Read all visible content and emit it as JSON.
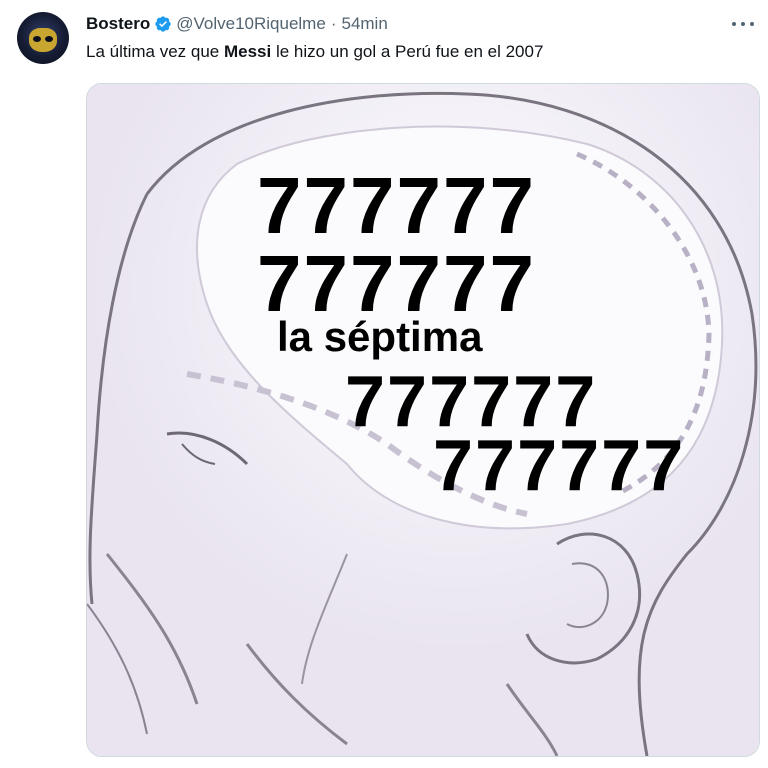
{
  "tweet": {
    "display_name": "Bostero",
    "handle": "@Volve10Riquelme",
    "separator": "·",
    "timestamp": "54min",
    "text_before": "La última vez que ",
    "text_bold": "Messi",
    "text_after": " le hizo un gol a Perú fue en el 2007",
    "verified_color": "#1d9bf0"
  },
  "meme": {
    "line1": "777777",
    "line2": "777777",
    "line3": "la séptima",
    "line4": "777777",
    "line5": "777777"
  },
  "icons": {
    "verified": "verified-badge-icon",
    "more": "more-options-icon"
  }
}
